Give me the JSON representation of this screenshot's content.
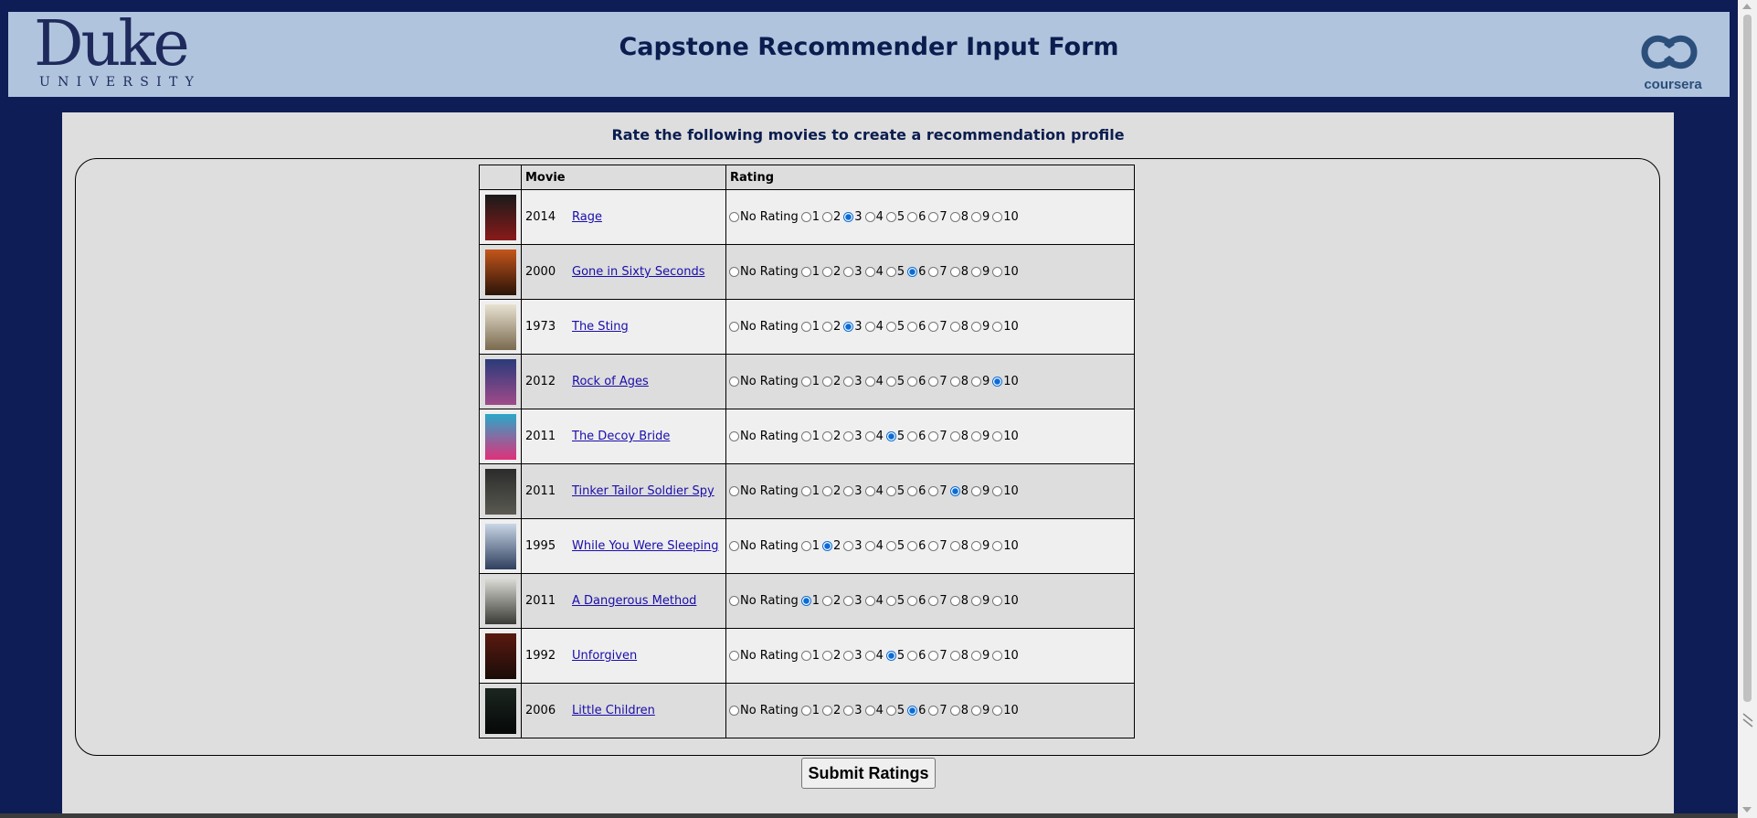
{
  "header": {
    "logo_left": {
      "word": "Duke",
      "sub": "UNIVERSITY"
    },
    "title": "Capstone Recommender Input Form",
    "logo_right": {
      "word": "coursera"
    }
  },
  "form": {
    "heading": "Rate the following movies to create a recommendation profile",
    "columns": [
      "",
      "Movie",
      "Rating"
    ],
    "rating_options": [
      "No Rating",
      "1",
      "2",
      "3",
      "4",
      "5",
      "6",
      "7",
      "8",
      "9",
      "10"
    ],
    "movies": [
      {
        "year": "2014",
        "title": "Rage",
        "selected": "3",
        "poster_icon": "movie-poster-icon",
        "poster_colors": [
          "#1a1a1a",
          "#8a1a1a"
        ]
      },
      {
        "year": "2000",
        "title": "Gone in Sixty Seconds",
        "selected": "6",
        "poster_icon": "movie-poster-icon",
        "poster_colors": [
          "#c4561b",
          "#2a1308"
        ]
      },
      {
        "year": "1973",
        "title": "The Sting",
        "selected": "3",
        "poster_icon": "movie-poster-icon",
        "poster_colors": [
          "#e8e2d2",
          "#7a6a4e"
        ]
      },
      {
        "year": "2012",
        "title": "Rock of Ages",
        "selected": "10",
        "poster_icon": "movie-poster-icon",
        "poster_colors": [
          "#2a3b7a",
          "#a04a8a"
        ]
      },
      {
        "year": "2011",
        "title": "The Decoy Bride",
        "selected": "5",
        "poster_icon": "movie-poster-icon",
        "poster_colors": [
          "#2aa8c9",
          "#e0307a"
        ]
      },
      {
        "year": "2011",
        "title": "Tinker Tailor Soldier Spy",
        "selected": "8",
        "poster_icon": "movie-poster-icon",
        "poster_colors": [
          "#2b2b2b",
          "#5a5a52"
        ]
      },
      {
        "year": "1995",
        "title": "While You Were Sleeping",
        "selected": "2",
        "poster_icon": "movie-poster-icon",
        "poster_colors": [
          "#c9d6e6",
          "#2f3f5e"
        ]
      },
      {
        "year": "2011",
        "title": "A Dangerous Method",
        "selected": "1",
        "poster_icon": "movie-poster-icon",
        "poster_colors": [
          "#dcdcd6",
          "#3a3a36"
        ]
      },
      {
        "year": "1992",
        "title": "Unforgiven",
        "selected": "5",
        "poster_icon": "movie-poster-icon",
        "poster_colors": [
          "#5a1a10",
          "#1a0c08"
        ]
      },
      {
        "year": "2006",
        "title": "Little Children",
        "selected": "6",
        "poster_icon": "movie-poster-icon",
        "poster_colors": [
          "#1c2620",
          "#050807"
        ]
      }
    ],
    "submit_label": "Submit Ratings"
  },
  "colors": {
    "page_bg": "#0e1d55",
    "banner_bg": "#b0c4de",
    "panel_bg": "#dedede",
    "title_text": "#0b1d4f",
    "link": "#1a0dab",
    "radio_checked": "#0b6bd6"
  }
}
